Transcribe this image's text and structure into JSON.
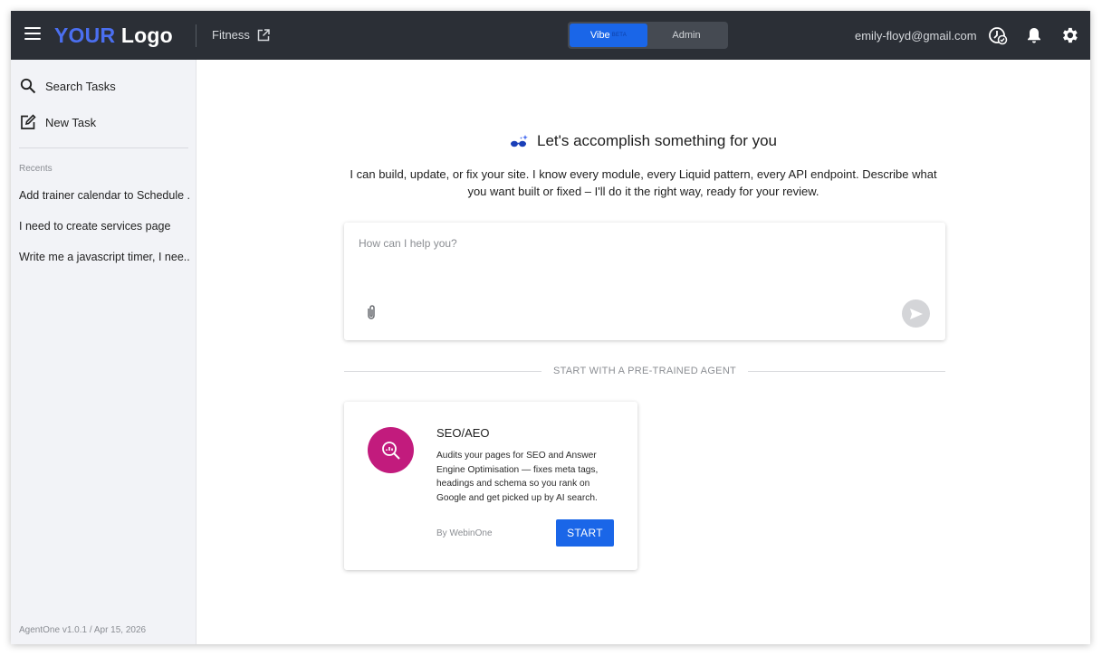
{
  "header": {
    "logo_part1": "YOUR",
    "logo_part2": "Logo",
    "site_name": "Fitness",
    "mode_toggle": {
      "active_label": "Vibe",
      "active_badge": "BETA",
      "inactive_label": "Admin"
    },
    "user_email": "emily-floyd@gmail.com",
    "icons": [
      "hamburger-menu-icon",
      "external-link-icon",
      "clock-check-icon",
      "bell-icon",
      "gear-icon"
    ]
  },
  "sidebar": {
    "actions": [
      {
        "label": "Search Tasks",
        "icon": "search-icon"
      },
      {
        "label": "New Task",
        "icon": "edit-icon"
      }
    ],
    "recents_heading": "Recents",
    "recents": [
      "Add trainer calendar to Schedule ...",
      "I need to create services page",
      "Write me a javascript timer, I nee..."
    ],
    "version": "AgentOne v1.0.1 / Apr 15, 2026"
  },
  "main": {
    "headline": "Let's accomplish something for you",
    "description": "I can build, update, or fix your site. I know every module, every Liquid pattern, every API endpoint. Describe what you want built or fixed – I'll do it the right way, ready for your review.",
    "prompt_placeholder": "How can I help you?",
    "divider_text": "START WITH A PRE-TRAINED AGENT",
    "agent_card": {
      "title": "SEO/AEO",
      "description": "Audits your pages for SEO and Answer Engine Optimisation — fixes meta tags, headings and schema so you rank on Google and get picked up by AI search.",
      "by": "By WebinOne",
      "button_label": "START"
    }
  },
  "colors": {
    "topbar": "#2b2f36",
    "accent_blue": "#1a66e8",
    "logo_blue": "#4b6ff0",
    "agent_avatar": "#c21b7d"
  }
}
